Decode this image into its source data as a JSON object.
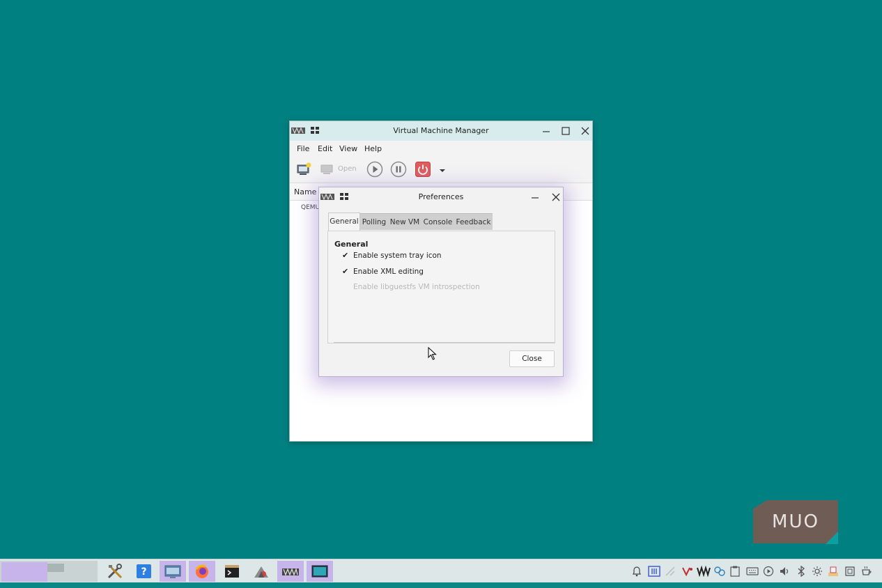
{
  "main_window": {
    "title": "Virtual Machine Manager",
    "menu": [
      "File",
      "Edit",
      "View",
      "Help"
    ],
    "toolbar": {
      "open_label": "Open"
    },
    "list": {
      "column_name": "Name",
      "rows": [
        "QEMU"
      ]
    }
  },
  "preferences": {
    "title": "Preferences",
    "tabs": [
      "General",
      "Polling",
      "New VM",
      "Console",
      "Feedback"
    ],
    "active_tab": "General",
    "section_title": "General",
    "options": [
      {
        "label": "Enable system tray icon",
        "checked": true,
        "enabled": true
      },
      {
        "label": "Enable XML editing",
        "checked": true,
        "enabled": true
      },
      {
        "label": "Enable libguestfs VM introspection",
        "checked": false,
        "enabled": false
      }
    ],
    "close_label": "Close"
  },
  "watermark": {
    "text": "MUO"
  },
  "colors": {
    "desktop": "#008080",
    "taskbar_highlight": "#c7b4ea",
    "dialog_glow": "#8c6ec8",
    "watermark_bg": "#6f5d55"
  },
  "taskbar": {
    "launchers": [
      "tools-icon",
      "help-icon",
      "window-list-icon",
      "firefox-icon",
      "terminal-icon",
      "installer-icon",
      "virt-manager-icon",
      "active-window-icon"
    ],
    "tray": [
      "bell-icon",
      "keyboard-layout-icon",
      "network-icon",
      "vivaldi-icon",
      "vm-icon",
      "settings-icon",
      "clipboard-icon",
      "keyboard-icon",
      "media-icon",
      "volume-icon",
      "bluetooth-icon",
      "brightness-icon",
      "notes-icon",
      "screenshot-icon",
      "caffeine-icon"
    ]
  }
}
